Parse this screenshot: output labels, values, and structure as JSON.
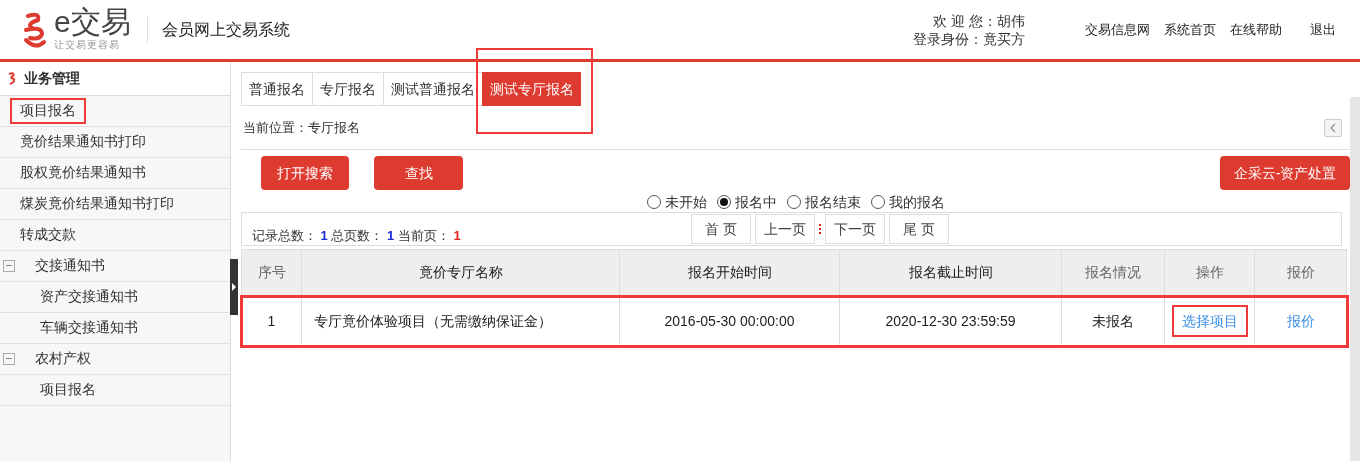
{
  "header": {
    "logo_text": "e交易",
    "logo_slogan": "让交易更容易",
    "system_title": "会员网上交易系统",
    "welcome_label": "欢 迎 您：",
    "user_name": "胡伟",
    "role_label": "登录身份：",
    "role": "竟买方",
    "links": [
      "交易信息网",
      "系统首页",
      "在线帮助",
      "退出"
    ]
  },
  "sidebar": {
    "title": "业务管理",
    "items": [
      {
        "kind": "item",
        "label": "项目报名",
        "highlighted": true
      },
      {
        "kind": "item",
        "label": "竟价结果通知书打印",
        "highlighted": false
      },
      {
        "kind": "item",
        "label": "股权竟价结果通知书",
        "highlighted": false
      },
      {
        "kind": "item",
        "label": "煤炭竟价结果通知书打印",
        "highlighted": false
      },
      {
        "kind": "item",
        "label": "转成交款",
        "highlighted": false
      },
      {
        "kind": "group",
        "label": "交接通知书",
        "expanded": true,
        "highlighted": false,
        "children": [
          {
            "label": "资产交接通知书",
            "highlighted": false
          },
          {
            "label": "车辆交接通知书",
            "highlighted": false
          }
        ]
      },
      {
        "kind": "group",
        "label": "农村产权",
        "expanded": true,
        "highlighted": false,
        "children": [
          {
            "label": "项目报名",
            "highlighted": false
          }
        ]
      }
    ]
  },
  "tabs": [
    {
      "label": "普通报名",
      "selected": false,
      "highlighted": false
    },
    {
      "label": "专厅报名",
      "selected": false,
      "highlighted": false
    },
    {
      "label": "测试普通报名",
      "selected": false,
      "highlighted": false
    },
    {
      "label": "测试专厅报名",
      "selected": true,
      "highlighted": true
    }
  ],
  "breadcrumb": "当前位置：专厅报名",
  "buttons": [
    "打开搜索",
    "查找"
  ],
  "right_button": "企采云-资产处置",
  "filters": [
    {
      "label": "未开始",
      "selected": false
    },
    {
      "label": "报名中",
      "selected": true
    },
    {
      "label": "报名结束",
      "selected": false
    },
    {
      "label": "我的报名",
      "selected": false
    }
  ],
  "pager": {
    "total_label": "记录总数：",
    "total": "1",
    "pages_label": "总页数：",
    "pages": "1",
    "current_label": "当前页：",
    "current": "1",
    "buttons": [
      "首 页",
      "上一页",
      "下一页",
      "尾 页"
    ]
  },
  "table": {
    "columns": [
      "序号",
      "竟价专厅名称",
      "报名开始时间",
      "报名截止时间",
      "报名情况",
      "操作",
      "报价"
    ],
    "rows": [
      {
        "highlighted": true,
        "cells": [
          "1",
          "专厅竟价体验项目（无需缴纳保证金）",
          "2016-05-30 00:00:00",
          "2020-12-30 23:59:59",
          "未报名"
        ],
        "action": "选择项目",
        "action_highlighted": true,
        "quote": "报价"
      }
    ]
  }
}
